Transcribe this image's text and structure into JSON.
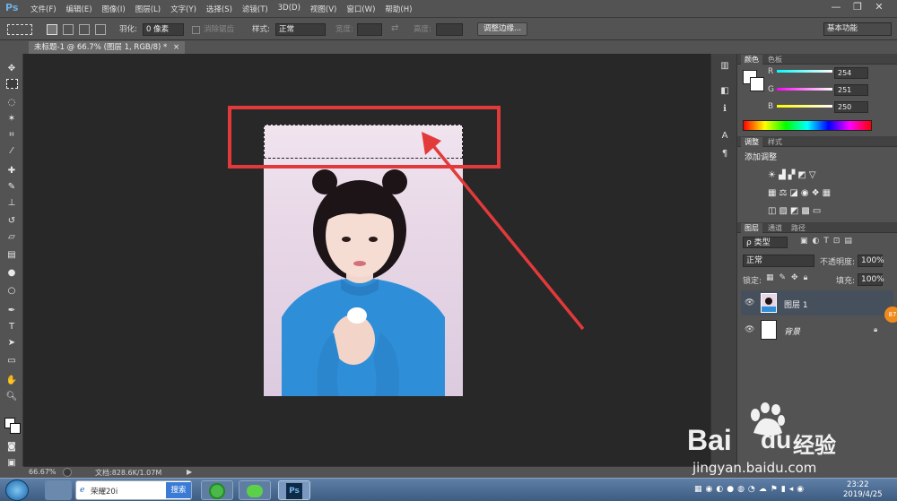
{
  "app": {
    "logo": "Ps"
  },
  "menu": [
    "文件(F)",
    "编辑(E)",
    "图像(I)",
    "图层(L)",
    "文字(Y)",
    "选择(S)",
    "滤镜(T)",
    "3D(D)",
    "视图(V)",
    "窗口(W)",
    "帮助(H)"
  ],
  "window_controls": {
    "minimize": "—",
    "restore": "❐",
    "close": "✕"
  },
  "options": {
    "feather_label": "羽化:",
    "feather_value": "0 像素",
    "antialias_label": "消除锯齿",
    "style_label": "样式:",
    "style_value": "正常",
    "width_label": "宽度:",
    "height_label": "高度:",
    "refine_button": "调整边缘...",
    "workspace": "基本功能"
  },
  "document": {
    "tab_title": "未标题-1 @ 66.7% (图层 1, RGB/8) *",
    "tab_close": "×"
  },
  "status": {
    "zoom": "66.67%",
    "doc_size": "文档:828.6K/1.07M"
  },
  "panels": {
    "color": {
      "tab_active": "颜色",
      "tab_other": "色板",
      "r_label": "R",
      "r_value": "254",
      "g_label": "G",
      "g_value": "251",
      "b_label": "B",
      "b_value": "250"
    },
    "adjust": {
      "tab_active": "调整",
      "tab_other": "样式",
      "title": "添加调整"
    },
    "layers": {
      "tab_active": "图层",
      "tab_channels": "通道",
      "tab_paths": "路径",
      "kind_label": "ρ 类型",
      "blend_mode": "正常",
      "opacity_label": "不透明度:",
      "opacity_value": "100%",
      "lock_label": "锁定:",
      "fill_label": "填充:",
      "fill_value": "100%",
      "items": [
        {
          "name": "图层 1",
          "selected": true
        },
        {
          "name": "背景",
          "selected": false
        }
      ]
    }
  },
  "taskbar": {
    "search_value": "荣耀20i",
    "search_button": "搜索",
    "time": "23:22",
    "date": "2019/4/25",
    "badge": "87"
  },
  "watermark": {
    "brand": "Bai",
    "brand_suffix": "经验",
    "url": "jingyan.baidu.com"
  },
  "colors": {
    "annotation_red": "#e23a3a",
    "ps_blue": "#6fb1e4",
    "panel_bg": "#535353",
    "canvas_bg": "#282828"
  }
}
